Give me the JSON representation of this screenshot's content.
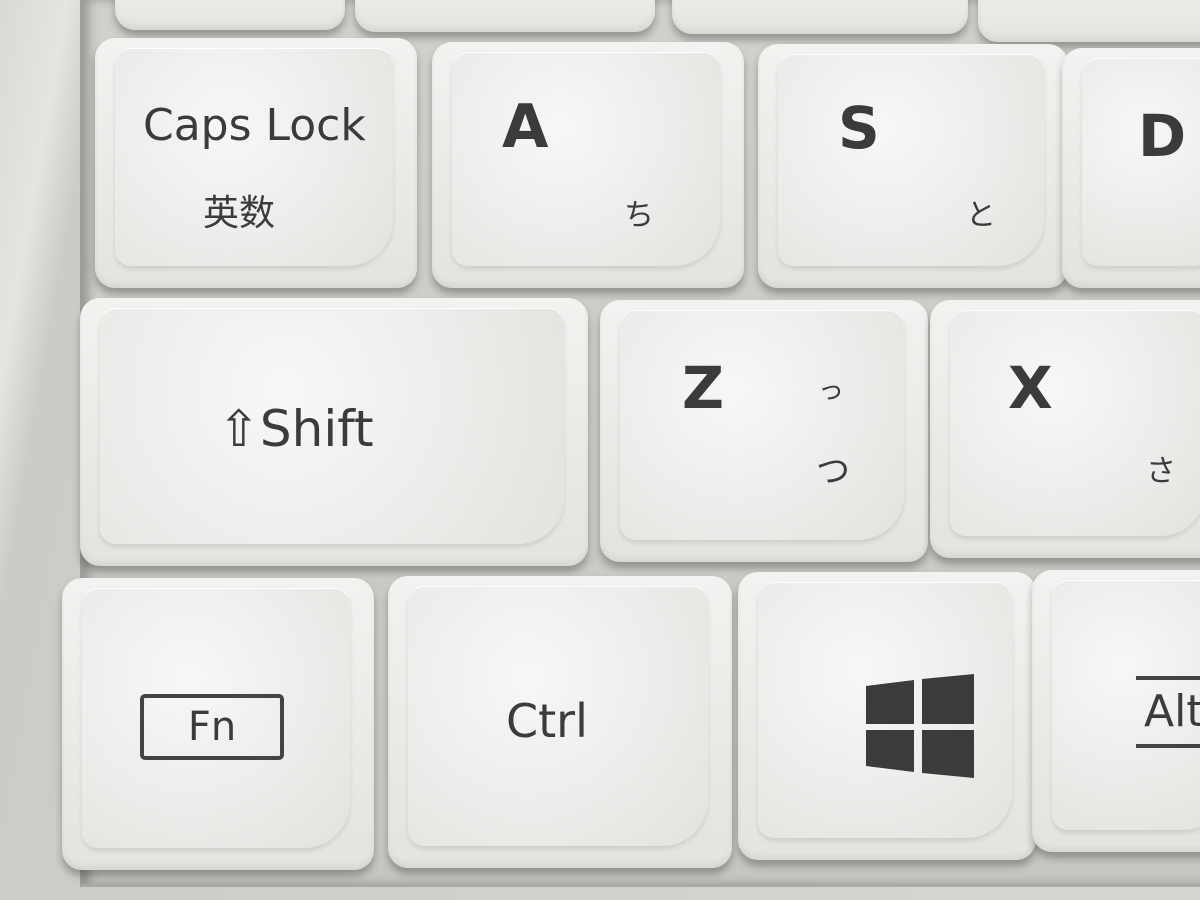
{
  "keys": {
    "caps_lock": {
      "label": "Caps Lock",
      "sub": "英数"
    },
    "a": {
      "label": "A",
      "kana": "ち"
    },
    "s": {
      "label": "S",
      "kana": "と"
    },
    "d": {
      "label": "D"
    },
    "shift": {
      "label": "⇧Shift"
    },
    "z": {
      "label": "Z",
      "kana_small": "っ",
      "kana": "つ"
    },
    "x": {
      "label": "X",
      "kana": "さ"
    },
    "fn": {
      "label": "Fn"
    },
    "ctrl": {
      "label": "Ctrl"
    },
    "windows": {
      "icon": "windows-logo-icon"
    },
    "alt": {
      "label": "Alt"
    }
  },
  "colors": {
    "key_face": "#ececea",
    "legend": "#3b3b3b",
    "tray": "#c8c8c5"
  }
}
